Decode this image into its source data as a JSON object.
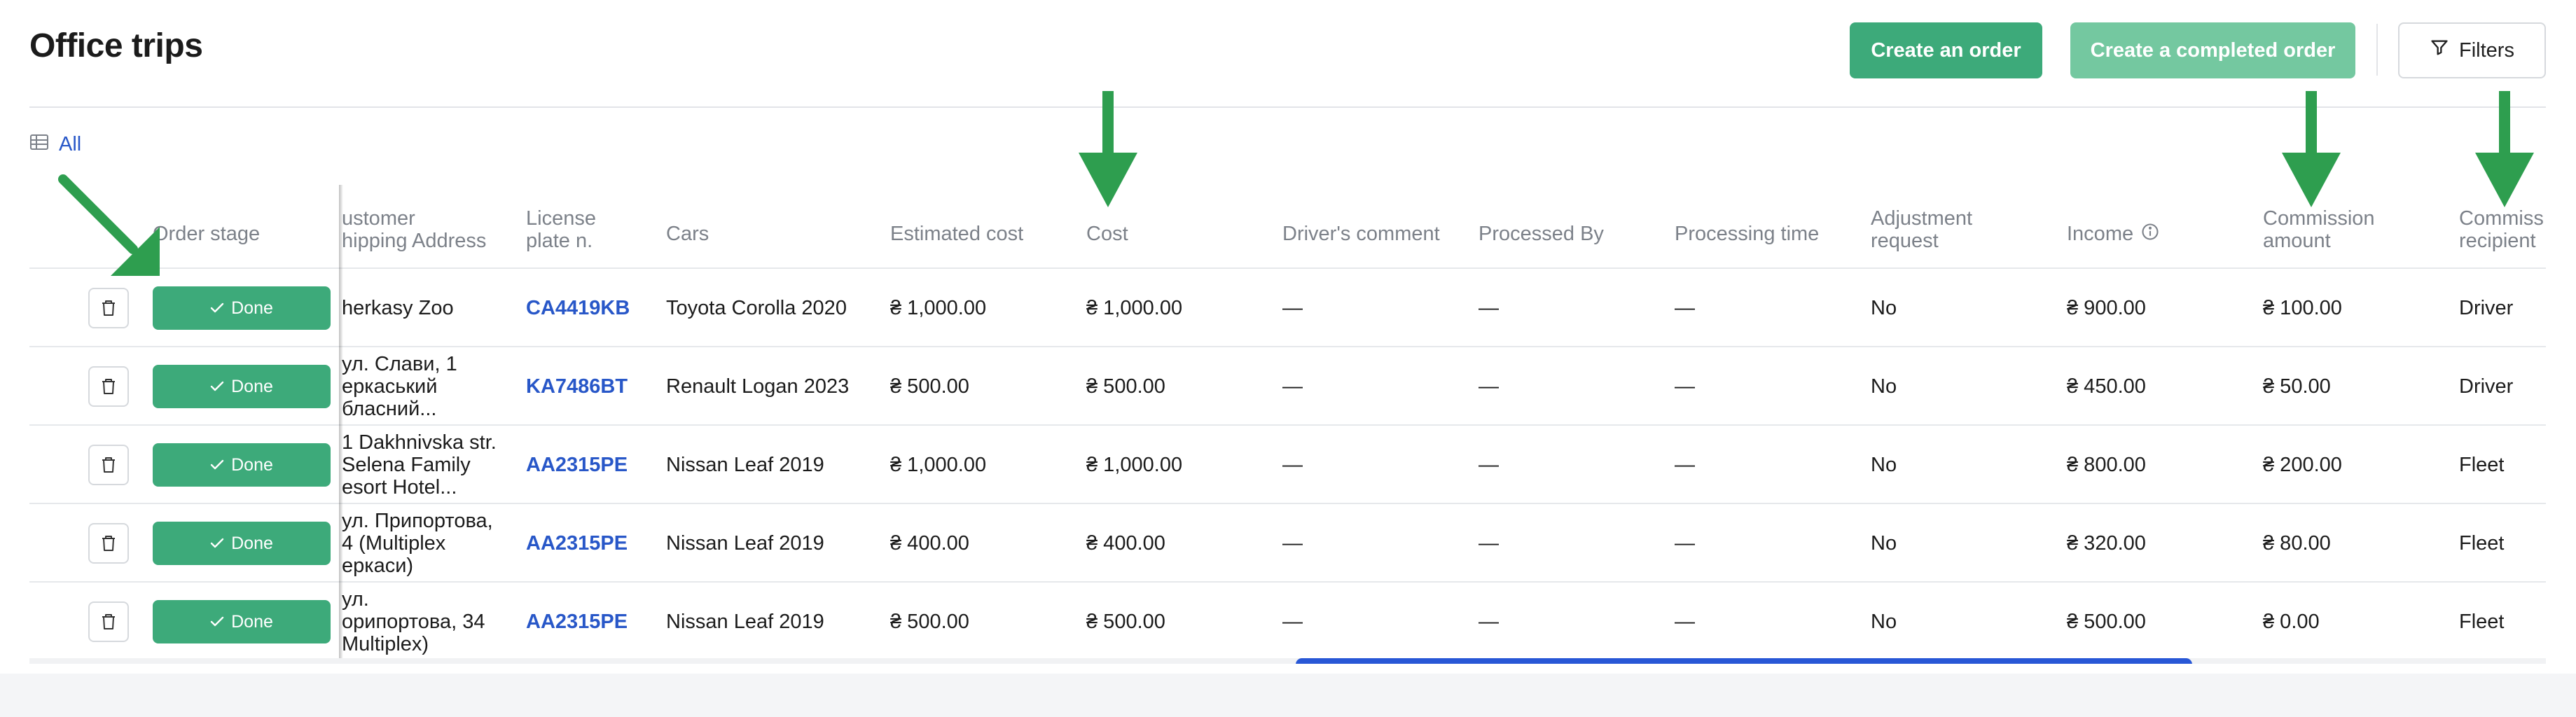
{
  "page": {
    "title": "Office trips"
  },
  "toolbar": {
    "create_order": "Create an order",
    "create_completed_order": "Create a completed order",
    "filters": "Filters"
  },
  "views": {
    "all": "All"
  },
  "table": {
    "headers": {
      "order_stage": "Order stage",
      "customer_address": "ustomer\nhipping Address",
      "license_plate": "License\nplate n.",
      "cars": "Cars",
      "estimated_cost": "Estimated cost",
      "cost": "Cost",
      "drivers_comment": "Driver's comment",
      "processed_by": "Processed By",
      "processing_time": "Processing time",
      "adjustment_request": "Adjustment\nrequest",
      "income": "Income",
      "commission_amount": "Commission\namount",
      "commission_recipient": "Commiss\nrecipient"
    },
    "stage_label": "Done",
    "rows": [
      {
        "address": "herkasy Zoo",
        "plate": "CA4419KB",
        "car": "Toyota Corolla 2020",
        "estimated": "₴ 1,000.00",
        "cost": "₴ 1,000.00",
        "comment": "—",
        "processed_by": "—",
        "processing_time": "—",
        "adjustment": "No",
        "income": "₴ 900.00",
        "commission": "₴ 100.00",
        "recipient": "Driver"
      },
      {
        "address": "ул. Слави, 1\nеркаський\nбласний...",
        "plate": "KA7486BT",
        "car": "Renault Logan 2023",
        "estimated": "₴ 500.00",
        "cost": "₴ 500.00",
        "comment": "—",
        "processed_by": "—",
        "processing_time": "—",
        "adjustment": "No",
        "income": "₴ 450.00",
        "commission": "₴ 50.00",
        "recipient": "Driver"
      },
      {
        "address": "1 Dakhnivska str.\nSelena Family\nesort Hotel...",
        "plate": "AA2315PE",
        "car": "Nissan Leaf 2019",
        "estimated": "₴ 1,000.00",
        "cost": "₴ 1,000.00",
        "comment": "—",
        "processed_by": "—",
        "processing_time": "—",
        "adjustment": "No",
        "income": "₴ 800.00",
        "commission": "₴ 200.00",
        "recipient": "Fleet"
      },
      {
        "address": "ул. Припортова,\n4 (Multiplex\nеркаси)",
        "plate": "AA2315PE",
        "car": "Nissan Leaf 2019",
        "estimated": "₴ 400.00",
        "cost": "₴ 400.00",
        "comment": "—",
        "processed_by": "—",
        "processing_time": "—",
        "adjustment": "No",
        "income": "₴ 320.00",
        "commission": "₴ 80.00",
        "recipient": "Fleet"
      },
      {
        "address": "ул.\nорипортова, 34\nMultiplex)",
        "plate": "AA2315PE",
        "car": "Nissan Leaf 2019",
        "estimated": "₴ 500.00",
        "cost": "₴ 500.00",
        "comment": "—",
        "processed_by": "—",
        "processing_time": "—",
        "adjustment": "No",
        "income": "₴ 500.00",
        "commission": "₴ 0.00",
        "recipient": "Fleet"
      }
    ]
  },
  "colors": {
    "accent_green": "#3daa7a",
    "link_blue": "#2857c8",
    "arrow_green": "#2e9e4f",
    "scrollbar": "#2857d6"
  },
  "icons": {
    "filters": "funnel-icon",
    "view": "table-icon",
    "delete": "trash-icon",
    "done": "check-icon",
    "info": "info-icon"
  }
}
